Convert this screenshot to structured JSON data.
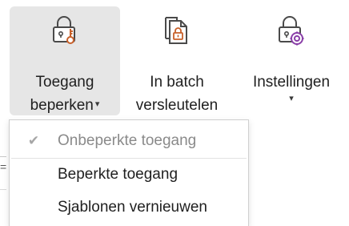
{
  "ribbon": {
    "restrict_access": {
      "label_line1": "Toegang",
      "label_line2": "beperken",
      "dropdown_glyph": "▾",
      "icon": "padlock-key-icon"
    },
    "batch_encrypt": {
      "label_line1": "In batch",
      "label_line2": "versleutelen",
      "icon": "documents-lock-icon"
    },
    "settings": {
      "label_line1": "Instellingen",
      "dropdown_glyph": "▾",
      "icon": "padlock-gear-icon"
    }
  },
  "menu": {
    "check_glyph": "✔",
    "items": [
      {
        "label": "Onbeperkte toegang",
        "checked": true,
        "enabled": false
      },
      {
        "label": "Beperkte toegang",
        "checked": false,
        "enabled": true
      },
      {
        "label": "Sjablonen vernieuwen",
        "checked": false,
        "enabled": true
      }
    ]
  },
  "colors": {
    "accent_orange": "#c8602a",
    "accent_purple": "#8a3fa8",
    "icon_gray": "#4a4a4a",
    "active_bg": "#e6e6e6"
  }
}
